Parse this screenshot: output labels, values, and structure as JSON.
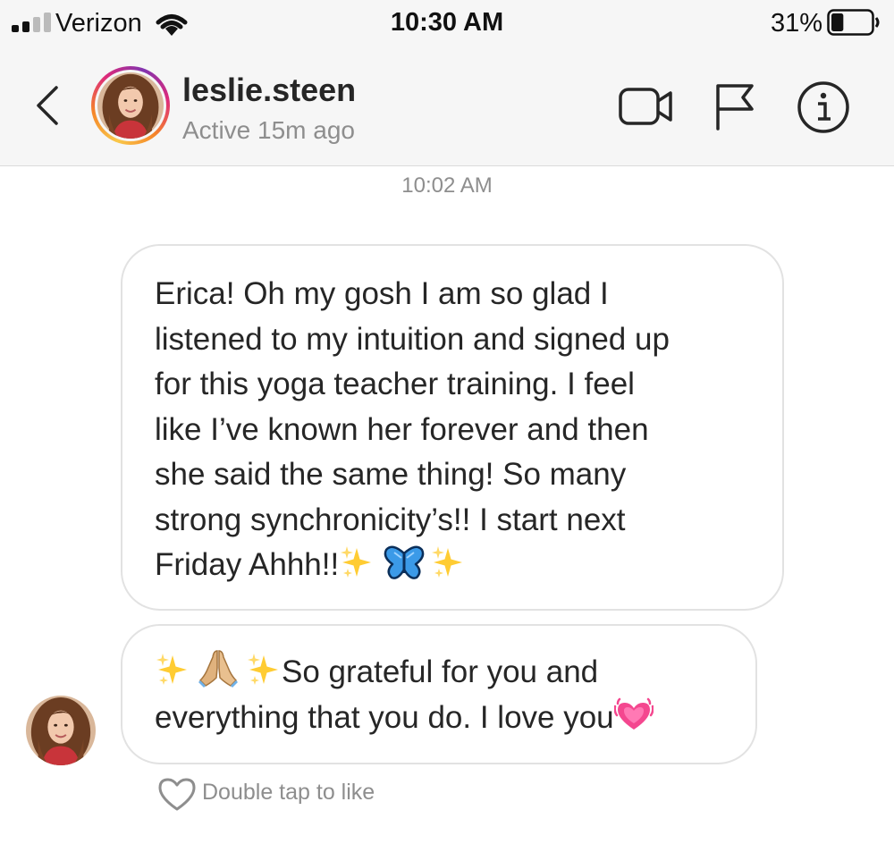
{
  "status_bar": {
    "carrier": "Verizon",
    "time": "10:30 AM",
    "battery": "31%",
    "battery_level": 0.31
  },
  "header": {
    "username": "leslie.steen",
    "active_status": "Active 15m ago",
    "icons": [
      "back-icon",
      "video-call-icon",
      "flag-icon",
      "info-icon"
    ]
  },
  "thread": {
    "timestamp": "10:02 AM",
    "messages": [
      {
        "lines": [
          "Erica! Oh my gosh I am so glad I",
          "listened to my intuition and signed up",
          "for this yoga teacher training. I feel",
          "like I’ve known her forever and then",
          "she said the same thing! So many",
          "strong synchronicity’s!! I start next",
          "Friday Ahhh!!"
        ],
        "emojis": [
          "sparkles",
          "butterfly",
          "sparkles"
        ]
      },
      {
        "emojis_lead": [
          "sparkles",
          "folded-hands",
          "sparkles"
        ],
        "lines": [
          "So grateful for you and",
          "everything that you do. I love you"
        ],
        "emojis_trail": [
          "growing-heart"
        ]
      }
    ],
    "like_hint": "Double tap to like"
  },
  "colors": {
    "header_bg": "#f6f6f6",
    "bubble_border": "#e2e2e2",
    "secondary_text": "#8e8e8e",
    "primary_text": "#262626"
  }
}
